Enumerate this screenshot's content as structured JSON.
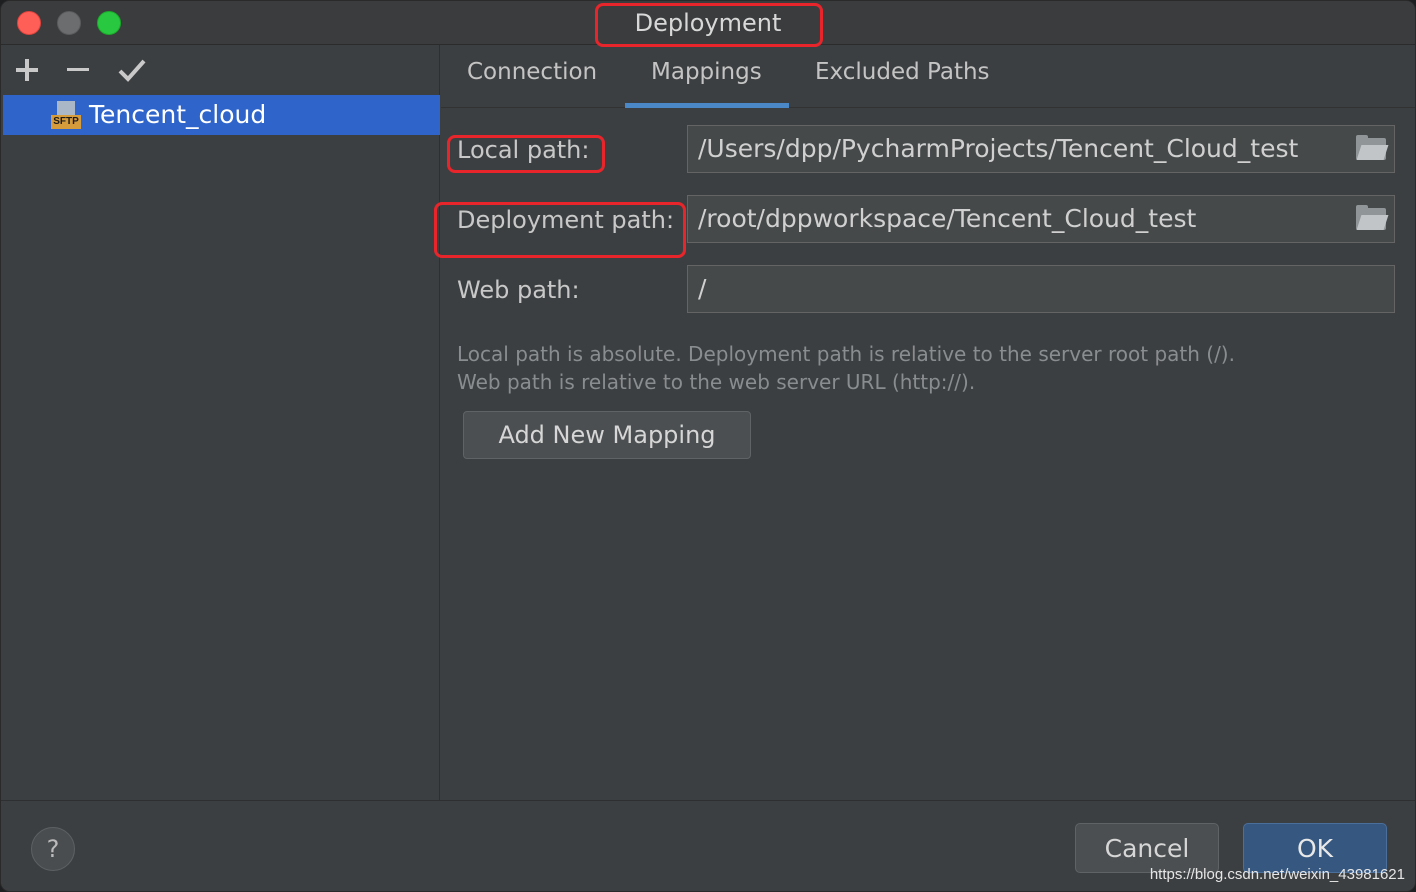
{
  "window": {
    "title": "Deployment"
  },
  "toolbar": {
    "add_icon": "plus-icon",
    "remove_icon": "minus-icon",
    "apply_icon": "check-icon"
  },
  "servers": [
    {
      "name": "Tencent_cloud",
      "icon_badge": "SFTP",
      "selected": true
    }
  ],
  "tabs": [
    {
      "label": "Connection",
      "active": false
    },
    {
      "label": "Mappings",
      "active": true
    },
    {
      "label": "Excluded Paths",
      "active": false
    }
  ],
  "mappings": {
    "local_path_label": "Local path:",
    "local_path_value": "/Users/dpp/PycharmProjects/Tencent_Cloud_test",
    "deployment_path_label": "Deployment path:",
    "deployment_path_value": "/root/dppworkspace/Tencent_Cloud_test",
    "web_path_label": "Web path:",
    "web_path_value": "/",
    "hint_line1": "Local path is absolute. Deployment path is relative to the server root path (/).",
    "hint_line2": "Web path is relative to the web server URL (http://).",
    "add_mapping_label": "Add New Mapping"
  },
  "footer": {
    "help_label": "?",
    "cancel_label": "Cancel",
    "ok_label": "OK"
  },
  "watermark": "https://blog.csdn.net/weixin_43981621",
  "colors": {
    "accent": "#2f65ca",
    "annotation": "#e8252b",
    "tab_underline": "#4a88c7"
  }
}
